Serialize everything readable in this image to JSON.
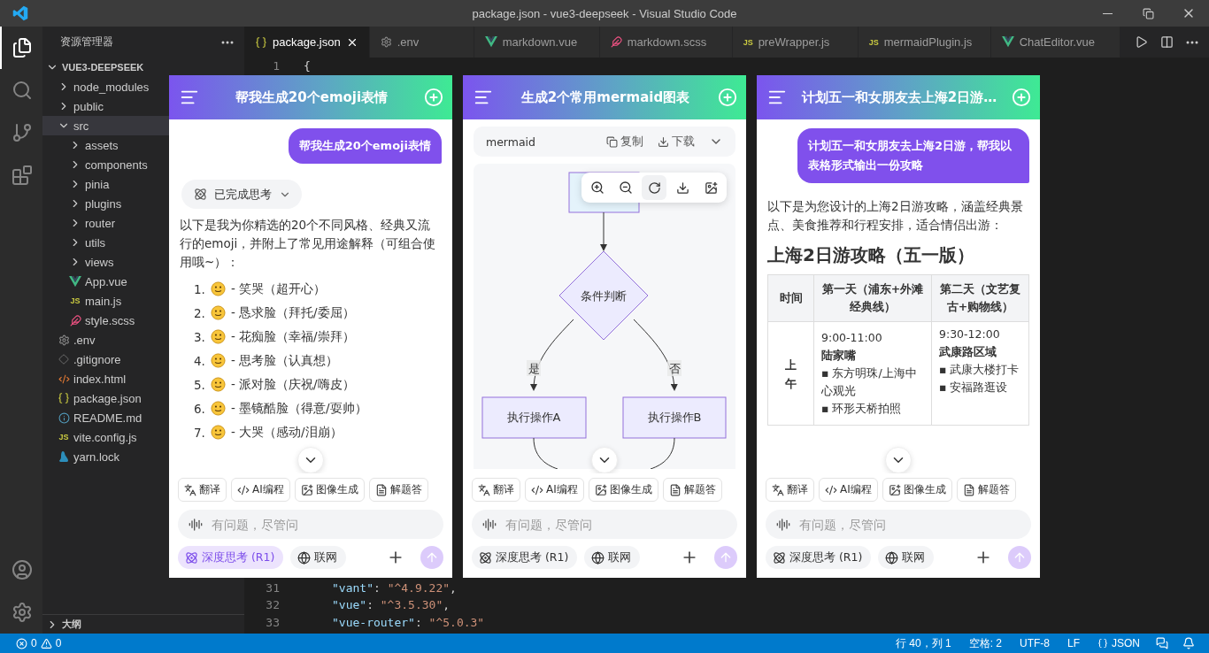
{
  "title_bar": {
    "title": "package.json - vue3-deepseek - Visual Studio Code"
  },
  "activity_bar": [
    {
      "kind": "explorer",
      "selected": true
    },
    {
      "kind": "search",
      "selected": false
    },
    {
      "kind": "source_control",
      "selected": false
    },
    {
      "kind": "extensions",
      "selected": false
    }
  ],
  "sidebar": {
    "title": "资源管理器",
    "tree": {
      "label": "VUE3-DEEPSEEK",
      "expanded": true,
      "children": [
        {
          "label": "node_modules",
          "kind": "folder",
          "expanded": false,
          "selected": false
        },
        {
          "label": "public",
          "kind": "folder",
          "expanded": false,
          "selected": false
        },
        {
          "label": "src",
          "kind": "folder",
          "expanded": true,
          "selected": true,
          "children": [
            {
              "label": "assets",
              "kind": "folder",
              "expanded": false,
              "selected": false
            },
            {
              "label": "components",
              "kind": "folder",
              "expanded": false,
              "selected": false
            },
            {
              "label": "pinia",
              "kind": "folder",
              "expanded": false,
              "selected": false
            },
            {
              "label": "plugins",
              "kind": "folder",
              "expanded": false,
              "selected": false
            },
            {
              "label": "router",
              "kind": "folder",
              "expanded": false,
              "selected": false
            },
            {
              "label": "utils",
              "kind": "folder",
              "expanded": false,
              "selected": false
            },
            {
              "label": "views",
              "kind": "folder",
              "expanded": false,
              "selected": false
            },
            {
              "label": "App.vue",
              "kind": "vue",
              "selected": false
            },
            {
              "label": "main.js",
              "kind": "js",
              "badge": "JS",
              "selected": false
            },
            {
              "label": "style.scss",
              "kind": "scss",
              "selected": false
            }
          ]
        },
        {
          "label": ".env",
          "kind": "env",
          "selected": false
        },
        {
          "label": ".gitignore",
          "kind": "git",
          "selected": false
        },
        {
          "label": "index.html",
          "kind": "html",
          "selected": false
        },
        {
          "label": "package.json",
          "kind": "json",
          "selected": false
        },
        {
          "label": "README.md",
          "kind": "info",
          "selected": false
        },
        {
          "label": "vite.config.js",
          "kind": "js",
          "badge": "JS",
          "selected": false
        },
        {
          "label": "yarn.lock",
          "kind": "yarn",
          "selected": false
        }
      ]
    },
    "outline": {
      "label": "大纲",
      "expanded": false
    }
  },
  "tabs": [
    {
      "label": "package.json",
      "kind": "json",
      "selected": true
    },
    {
      "label": ".env",
      "kind": "env",
      "selected": false
    },
    {
      "label": "markdown.vue",
      "kind": "vue",
      "selected": false
    },
    {
      "label": "markdown.scss",
      "kind": "scss",
      "selected": false
    },
    {
      "label": "preWrapper.js",
      "kind": "js",
      "badge": "JS",
      "selected": false
    },
    {
      "label": "mermaidPlugin.js",
      "kind": "js",
      "badge": "JS",
      "selected": false
    },
    {
      "label": "ChatEditor.vue",
      "kind": "vue",
      "selected": false
    }
  ],
  "code_top": [
    {
      "number": "1",
      "kind": "brace",
      "text": "{"
    }
  ],
  "code_bottom": [
    {
      "number": "31",
      "kind": "pair",
      "key": "\"vant\"",
      "sep": ":",
      "value": "\"^4.9.22\"",
      "end": ","
    },
    {
      "number": "32",
      "kind": "pair",
      "key": "\"vue\"",
      "sep": ":",
      "value": "\"^3.5.30\"",
      "end": ","
    },
    {
      "number": "33",
      "kind": "pair",
      "key": "\"vue-router\"",
      "sep": ":",
      "value": "\"^5.0.3\""
    }
  ],
  "panels": [
    {
      "title": "帮我生成20个emoji表情",
      "blocks": [
        {
          "kind": "user",
          "text": "帮我生成20个emoji表情"
        },
        {
          "kind": "thinking",
          "text": "已完成思考",
          "expanded": false
        },
        {
          "kind": "paragraph",
          "text": "以下是我为你精选的20个不同风格、经典又流行的emoji，并附上了常见用途解释（可组合使用哦~）："
        },
        {
          "kind": "list",
          "items": [
            {
              "number": "1.",
              "text": "- 笑哭（超开心）"
            },
            {
              "number": "2.",
              "text": "- 恳求脸（拜托/委屈）"
            },
            {
              "number": "3.",
              "text": "- 花痴脸（幸福/崇拜）"
            },
            {
              "number": "4.",
              "text": "- 思考脸（认真想）"
            },
            {
              "number": "5.",
              "text": "- 派对脸（庆祝/嗨皮）"
            },
            {
              "number": "6.",
              "text": "- 墨镜酷脸（得意/耍帅）"
            },
            {
              "number": "7.",
              "text": "- 大哭（感动/泪崩）"
            }
          ]
        }
      ],
      "quick_actions": [
        {
          "kind": "translate",
          "label": "翻译"
        },
        {
          "kind": "code",
          "label": "AI编程"
        },
        {
          "kind": "image",
          "label": "图像生成"
        },
        {
          "kind": "solve",
          "label": "解题答"
        }
      ],
      "placeholder": "有问题，尽管问",
      "options": [
        {
          "kind": "deep",
          "label": "深度思考 (R1)",
          "selected": true
        },
        {
          "kind": "web",
          "label": "联网",
          "selected": false
        }
      ],
      "send_enabled": false
    },
    {
      "title": "生成2个常用mermaid图表",
      "blocks": [
        {
          "kind": "code_header",
          "language": "mermaid",
          "copy": "复制",
          "download": "下载"
        },
        {
          "kind": "flowchart",
          "decision": "条件判断",
          "yes": "是",
          "no": "否",
          "left": "执行操作A",
          "right": "执行操作B",
          "tools": [
            {
              "kind": "zoom_in",
              "selected": false
            },
            {
              "kind": "zoom_out",
              "selected": false
            },
            {
              "kind": "reset",
              "selected": true
            },
            {
              "kind": "download",
              "selected": false
            },
            {
              "kind": "image",
              "selected": false
            }
          ]
        }
      ],
      "quick_actions": [
        {
          "kind": "translate",
          "label": "翻译"
        },
        {
          "kind": "code",
          "label": "AI编程"
        },
        {
          "kind": "image",
          "label": "图像生成"
        },
        {
          "kind": "solve",
          "label": "解题答"
        }
      ],
      "placeholder": "有问题，尽管问",
      "options": [
        {
          "kind": "deep",
          "label": "深度思考 (R1)",
          "selected": false
        },
        {
          "kind": "web",
          "label": "联网",
          "selected": false
        }
      ],
      "send_enabled": false
    },
    {
      "title": "计划五一和女朋友去上海2日游…",
      "blocks": [
        {
          "kind": "user",
          "text": "计划五一和女朋友去上海2日游，帮我以表格形式输出一份攻略"
        },
        {
          "kind": "paragraph",
          "text": "以下是为您设计的上海2日游攻略，涵盖经典景点、美食推荐和行程安排，适合情侣出游："
        },
        {
          "kind": "heading",
          "text": "上海2日游攻略（五一版）"
        },
        {
          "kind": "table",
          "columns": [
            "时间",
            "第一天（浦东+外滩经典线）",
            "第二天（文艺复古+购物线）"
          ],
          "rows": [
            {
              "cells": [
                {
                  "lines": [
                    {
                      "kind": "vertical",
                      "text": "上午"
                    }
                  ]
                },
                {
                  "lines": [
                    {
                      "kind": "plain",
                      "text": "9:00-11:00"
                    },
                    {
                      "kind": "bold",
                      "text": "陆家嘴"
                    },
                    {
                      "kind": "plain",
                      "text": "▪ 东方明珠/上海中心观光"
                    },
                    {
                      "kind": "plain",
                      "text": "▪ 环形天桥拍照"
                    }
                  ]
                },
                {
                  "lines": [
                    {
                      "kind": "plain",
                      "text": "9:30-12:00"
                    },
                    {
                      "kind": "bold",
                      "text": "武康路区域"
                    },
                    {
                      "kind": "plain",
                      "text": "▪ 武康大楼打卡"
                    },
                    {
                      "kind": "plain",
                      "text": "▪ 安福路逛设"
                    }
                  ]
                }
              ]
            }
          ]
        }
      ],
      "quick_actions": [
        {
          "kind": "translate",
          "label": "翻译"
        },
        {
          "kind": "code",
          "label": "AI编程"
        },
        {
          "kind": "image",
          "label": "图像生成"
        },
        {
          "kind": "solve",
          "label": "解题答"
        }
      ],
      "placeholder": "有问题，尽管问",
      "options": [
        {
          "kind": "deep",
          "label": "深度思考 (R1)",
          "selected": false
        },
        {
          "kind": "web",
          "label": "联网",
          "selected": false
        }
      ],
      "send_enabled": false
    }
  ],
  "status_bar": {
    "errors": "0",
    "warnings": "0",
    "items": [
      {
        "kind": "position",
        "text": "行 40，列 1"
      },
      {
        "kind": "plain",
        "text": "空格: 2"
      },
      {
        "kind": "plain",
        "text": "UTF-8"
      },
      {
        "kind": "plain",
        "text": "LF"
      },
      {
        "kind": "language",
        "text": "JSON"
      }
    ]
  }
}
